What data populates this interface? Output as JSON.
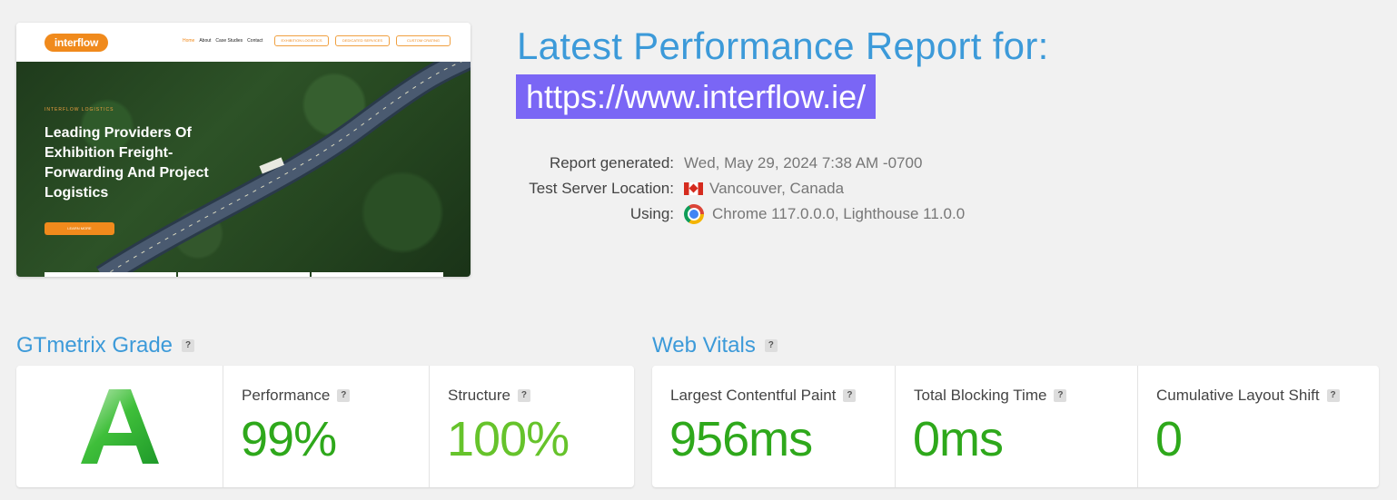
{
  "thumbnail": {
    "logo": "interflow",
    "nav_links": [
      "Home",
      "About",
      "Case Studies",
      "Contact"
    ],
    "nav_buttons": [
      "EXHIBITION LOGISTICS",
      "DEDICATED SERVICES",
      "CUSTOM CRATING"
    ],
    "kicker": "INTERFLOW LOGISTICS",
    "headline": "Leading Providers Of Exhibition Freight-Forwarding And Project Logistics",
    "cta": "LEARN MORE"
  },
  "report": {
    "title": "Latest Performance Report for:",
    "url": "https://www.interflow.ie/",
    "generated_label": "Report generated:",
    "generated_value": "Wed, May 29, 2024 7:38 AM -0700",
    "location_label": "Test Server Location:",
    "location_value": "Vancouver, Canada",
    "using_label": "Using:",
    "using_value": "Chrome 117.0.0.0, Lighthouse 11.0.0"
  },
  "grade": {
    "title": "GTmetrix Grade",
    "help": "?",
    "letter": "A",
    "performance_label": "Performance",
    "performance_value": "99%",
    "structure_label": "Structure",
    "structure_value": "100%"
  },
  "vitals": {
    "title": "Web Vitals",
    "help": "?",
    "lcp_label": "Largest Contentful Paint",
    "lcp_value": "956ms",
    "tbt_label": "Total Blocking Time",
    "tbt_value": "0ms",
    "cls_label": "Cumulative Layout Shift",
    "cls_value": "0"
  },
  "colors": {
    "accent": "#3c9ad9",
    "url_highlight": "#7a66f5",
    "grade_green": "#2ea81b",
    "structure_green": "#66c32b"
  },
  "icons": {
    "flag": "canada-flag-icon",
    "browser": "chrome-icon",
    "help": "help-icon"
  }
}
